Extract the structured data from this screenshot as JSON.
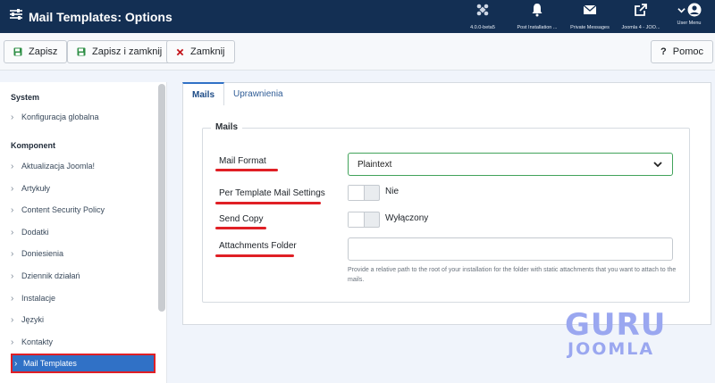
{
  "header": {
    "title": "Mail Templates: Options",
    "items": [
      {
        "icon": "joomla-icon",
        "label": "4.0.0-beta5"
      },
      {
        "icon": "bell-icon",
        "label": "Post Installation ..."
      },
      {
        "icon": "envelope-icon",
        "label": "Private Messages"
      },
      {
        "icon": "external-link-icon",
        "label": "Joomla 4 - JOO..."
      },
      {
        "icon": "user-icon",
        "label": "User Menu"
      }
    ]
  },
  "toolbar": {
    "save_label": "Zapisz",
    "save_close_label": "Zapisz i zamknij",
    "close_label": "Zamknij",
    "help_label": "Pomoc"
  },
  "sidebar": {
    "section_system": "System",
    "system_items": [
      "Konfiguracja globalna"
    ],
    "section_component": "Komponent",
    "component_items": [
      "Aktualizacja Joomla!",
      "Artykuły",
      "Content Security Policy",
      "Dodatki",
      "Doniesienia",
      "Dziennik działań",
      "Instalacje",
      "Języki",
      "Kontakty",
      "Mail Templates"
    ],
    "active_item": "Mail Templates"
  },
  "tabs": [
    {
      "label": "Mails",
      "active": true
    },
    {
      "label": "Uprawnienia",
      "active": false
    }
  ],
  "form": {
    "legend": "Mails",
    "mail_format_label": "Mail Format",
    "mail_format_value": "Plaintext",
    "per_template_label": "Per Template Mail Settings",
    "per_template_value": "Nie",
    "send_copy_label": "Send Copy",
    "send_copy_value": "Wyłączony",
    "attachments_label": "Attachments Folder",
    "attachments_value": "",
    "attachments_hint": "Provide a relative path to the root of your installation for the folder with static attachments that you want to attach to the mails."
  },
  "watermark": {
    "line1": "GURU",
    "line2": "JOOMLA"
  },
  "colors": {
    "header_bg": "#132f53",
    "accent": "#3071c6",
    "highlight": "#e01f25",
    "save_green": "#2f8f46",
    "close_red": "#c4161c"
  }
}
